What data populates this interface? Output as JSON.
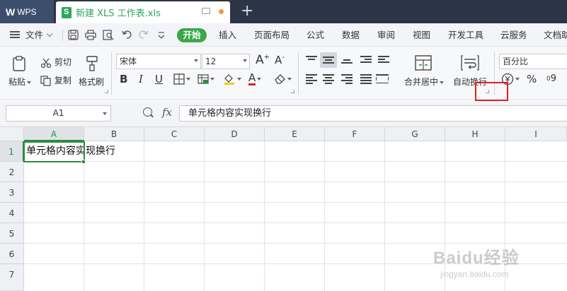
{
  "app": {
    "name": "WPS",
    "doc_title": "新建 XLS 工作表.xls",
    "new_tab": "+"
  },
  "menu": {
    "file": "文件",
    "start": "开始",
    "items": [
      "插入",
      "页面布局",
      "公式",
      "数据",
      "审阅",
      "视图",
      "开发工具",
      "云服务",
      "文档助"
    ]
  },
  "ribbon": {
    "paste": "粘贴",
    "cut": "剪切",
    "copy": "复制",
    "format_painter": "格式刷",
    "font_name": "宋体",
    "font_size": "12",
    "bold": "B",
    "italic": "I",
    "underline": "U",
    "font_color": "A",
    "grow": "A",
    "shrink": "A",
    "merge_center": "合并居中",
    "wrap_text": "自动换行",
    "number_format": "百分比",
    "percent": "%",
    "thousands": "9"
  },
  "formula_bar": {
    "name_box": "A1",
    "fx": "fx",
    "content": "单元格内容实现换行"
  },
  "grid": {
    "columns": [
      "A",
      "B",
      "C",
      "D",
      "E",
      "F",
      "G",
      "H",
      "I"
    ],
    "rows": [
      "1",
      "2",
      "3",
      "4",
      "5",
      "6",
      "7"
    ],
    "cell_a1": "单元格内容实现换行"
  },
  "watermark": {
    "main": "Baidu经验",
    "sub": "jingyan.baidu.com"
  },
  "colors": {
    "accent_green": "#2d8b3e",
    "start_button": "#3aa84a",
    "highlight_red": "#e02020",
    "tabbar": "#2b3547"
  }
}
